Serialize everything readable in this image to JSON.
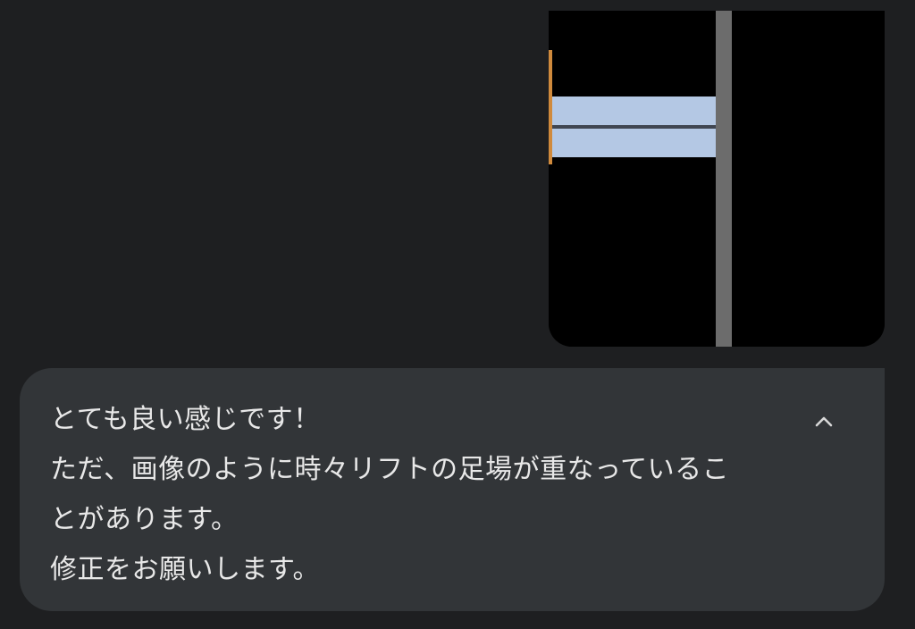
{
  "message": {
    "lines": [
      "とても良い感じです！",
      "ただ、画像のように時々リフトの足場が重なっているこ",
      "とがあります。",
      "修正をお願いします。"
    ]
  },
  "collapse_button": {
    "icon": "chevron-up-icon"
  },
  "attached_image": {
    "colors": {
      "background": "#000000",
      "platform": "#b4c8e4",
      "platform_seam": "#404652",
      "rail": "#6c6c6c",
      "edge_accent": "#d08a3c"
    }
  }
}
